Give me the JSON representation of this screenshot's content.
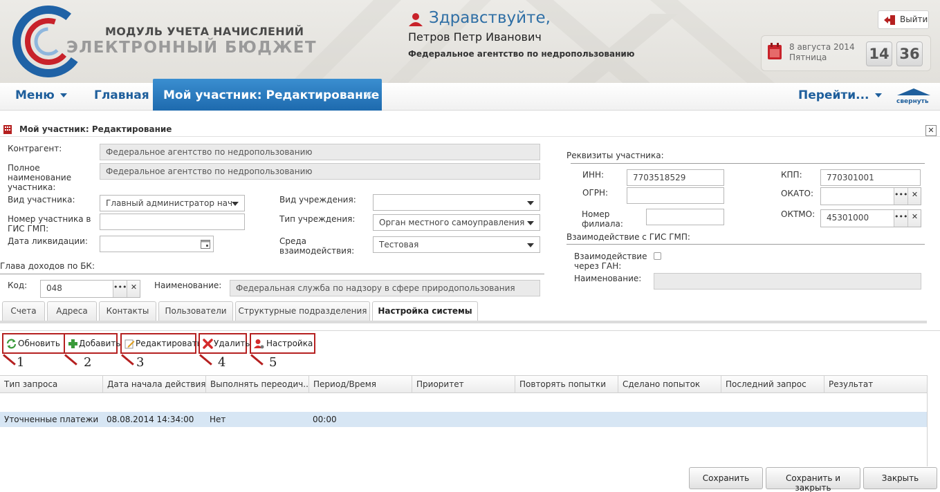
{
  "header": {
    "logo_line1": "МОДУЛЬ УЧЕТА НАЧИСЛЕНИЙ",
    "logo_line2": "ЭЛЕКТРОННЫЙ БЮДЖЕТ",
    "greeting": "Здравствуйте,",
    "user_name": "Петров Петр Иванович",
    "org_name": "Федеральное агентство по недропользованию",
    "logout_label": "Выйти",
    "date": "8 августа 2014",
    "weekday": "Пятница",
    "hours": "14",
    "minutes": "36"
  },
  "nav": {
    "menu_label": "Меню",
    "home_label": "Главная",
    "active_tab": "Мой участник: Редактирование",
    "goto_label": "Перейти...",
    "collapse_label": "свернуть"
  },
  "panel": {
    "title": "Мой участник: Редактирование"
  },
  "form": {
    "contractor_label": "Контрагент:",
    "contractor_value": "Федеральное агентство по недропользованию",
    "full_name_label_1": "Полное",
    "full_name_label_2": "наименование",
    "full_name_label_3": "участника:",
    "full_name_value": "Федеральное агентство по недропользованию",
    "participant_type_label": "Вид участника:",
    "participant_type_value": "Главный администратор нач",
    "gis_number_label_1": "Номер участника в",
    "gis_number_label_2": "ГИС ГМП:",
    "gis_number_value": "",
    "liquidation_label": "Дата ликвидации:",
    "liquidation_value": "",
    "institution_type_label": "Вид учреждения:",
    "institution_type_value": "",
    "institution_kind_label": "Тип учреждения:",
    "institution_kind_value": "Орган местного самоуправления",
    "environment_label_1": "Среда",
    "environment_label_2": "взаимодействия:",
    "environment_value": "Тестовая",
    "bk_head_label": "Глава доходов по БК:",
    "code_label": "Код:",
    "code_value": "048",
    "name_label": "Наименование:",
    "name_value": "Федеральная служба по надзору в сфере природопользования"
  },
  "requisites": {
    "title": "Реквизиты участника:",
    "inn_label": "ИНН:",
    "inn_value": "7703518529",
    "kpp_label": "КПП:",
    "kpp_value": "770301001",
    "ogrn_label": "ОГРН:",
    "ogrn_value": "",
    "okato_label": "ОКАТО:",
    "okato_value": "",
    "branch_label_1": "Номер",
    "branch_label_2": "филиала:",
    "branch_value": "",
    "oktmo_label": "ОКТМО:",
    "oktmo_value": "45301000",
    "gis_title": "Взаимодействие с ГИС ГМП:",
    "gan_label_1": "Взаимодействие",
    "gan_label_2": "через ГАН:",
    "gan_name_label": "Наименование:",
    "gan_name_value": ""
  },
  "tabs": [
    "Счета",
    "Адреса",
    "Контакты",
    "Пользователи",
    "Структурные подразделения",
    "Настройка системы"
  ],
  "toolbar": {
    "refresh": "Обновить",
    "add": "Добавить",
    "edit": "Редактировать",
    "delete": "Удалить",
    "settings": "Настройка",
    "n1": "1",
    "n2": "2",
    "n3": "3",
    "n4": "4",
    "n5": "5"
  },
  "grid": {
    "columns": [
      "Тип запроса",
      "Дата начала действия",
      "Выполнять переодич...",
      "Период/Время",
      "Приоритет",
      "Повторять попытки",
      "Сделано попыток",
      "Последний запрос",
      "Результат"
    ],
    "rows": [
      [
        "Уточненные платежи",
        "08.08.2014 14:34:00",
        "Нет",
        "00:00",
        "",
        "",
        "",
        "",
        ""
      ]
    ]
  },
  "footer": {
    "save": "Сохранить",
    "save_close": "Сохранить и закрыть",
    "close": "Закрыть"
  },
  "colors": {
    "accent_blue": "#1f5f9c",
    "tab_blue": "#2a7cc0",
    "highlight_red": "#b52020",
    "selected_row": "#d7e6f4"
  }
}
